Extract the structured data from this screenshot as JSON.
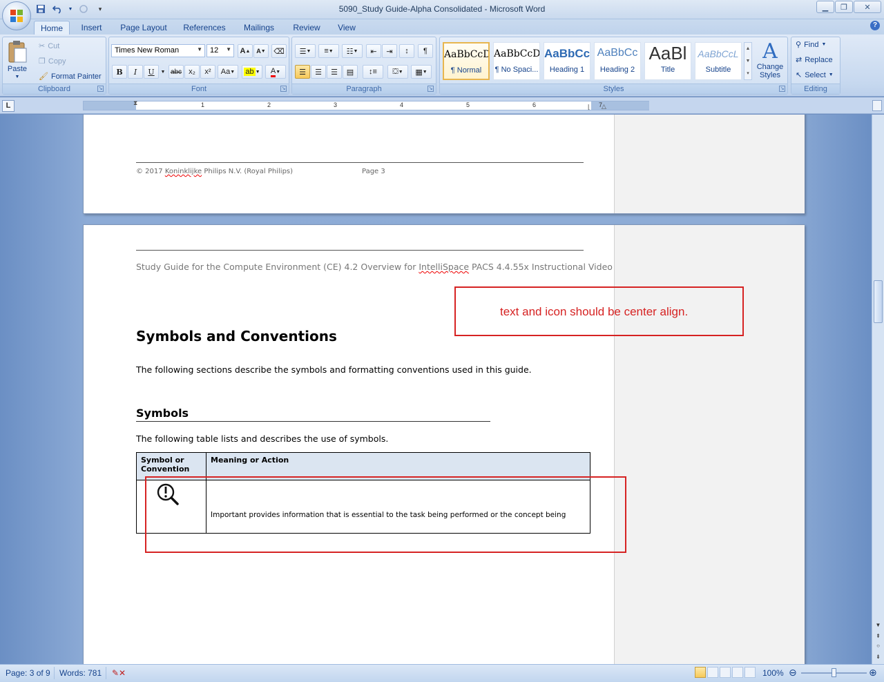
{
  "window": {
    "title": "5090_Study Guide-Alpha Consolidated - Microsoft Word",
    "controls": [
      "minimize",
      "maximize",
      "close"
    ]
  },
  "quick_access": [
    "save-icon",
    "undo-icon",
    "redo-icon",
    "customize-icon"
  ],
  "ribbon": {
    "tabs": [
      "Home",
      "Insert",
      "Page Layout",
      "References",
      "Mailings",
      "Review",
      "View"
    ],
    "active_tab": "Home",
    "clipboard": {
      "label": "Clipboard",
      "paste": "Paste",
      "cut": "Cut",
      "copy": "Copy",
      "format_painter": "Format Painter"
    },
    "font": {
      "label": "Font",
      "family": "Times New Roman",
      "size": "12",
      "bold": "B",
      "italic": "I",
      "underline": "U",
      "strike": "abc",
      "subscript": "x₂",
      "superscript": "x²",
      "change_case": "Aa",
      "grow": "A",
      "shrink": "A"
    },
    "paragraph": {
      "label": "Paragraph"
    },
    "styles": {
      "label": "Styles",
      "items": [
        {
          "sample": "AaBbCcDc",
          "name": "¶ Normal",
          "selected": true
        },
        {
          "sample": "AaBbCcDc",
          "name": "¶ No Spaci...",
          "selected": false
        },
        {
          "sample": "AaBbCc",
          "name": "Heading 1",
          "selected": false
        },
        {
          "sample": "AaBbCc",
          "name": "Heading 2",
          "selected": false
        },
        {
          "sample": "AaBl",
          "name": "Title",
          "selected": false
        },
        {
          "sample": "AaBbCcL",
          "name": "Subtitle",
          "selected": false
        }
      ],
      "change_styles": "Change Styles"
    },
    "editing": {
      "label": "Editing",
      "find": "Find",
      "replace": "Replace",
      "select": "Select"
    }
  },
  "ruler": {
    "numbers": [
      "1",
      "2",
      "3",
      "4",
      "5",
      "6",
      "7"
    ]
  },
  "document": {
    "prev_page_footer": {
      "copyright_pre": "© 2017 ",
      "copyright_word": "Koninklijke",
      "copyright_post": " Philips N.V. (Royal Philips)",
      "page_label": "Page 3"
    },
    "header": {
      "pre": "Study Guide for the Compute Environment (CE) 4.2 Overview for ",
      "word": "IntelliSpace",
      "post": " PACS 4.4.55x  Instructional Video"
    },
    "heading1": "Symbols and Conventions",
    "intro": "The following sections describe the symbols and formatting conventions used in this guide.",
    "heading2": "Symbols",
    "table_intro": "The following table lists and describes the use of symbols.",
    "table": {
      "headers": [
        "Symbol or Convention",
        "Meaning or Action"
      ],
      "rows": [
        {
          "symbol_icon": "important-magnifier-icon",
          "meaning": "Important provides information that is essential to the task being performed or the concept being"
        }
      ]
    }
  },
  "annotations": {
    "note": "text and icon should be center align.",
    "color": "#d62222"
  },
  "statusbar": {
    "page": "Page: 3 of 9",
    "words": "Words: 781",
    "zoom": "100%"
  }
}
